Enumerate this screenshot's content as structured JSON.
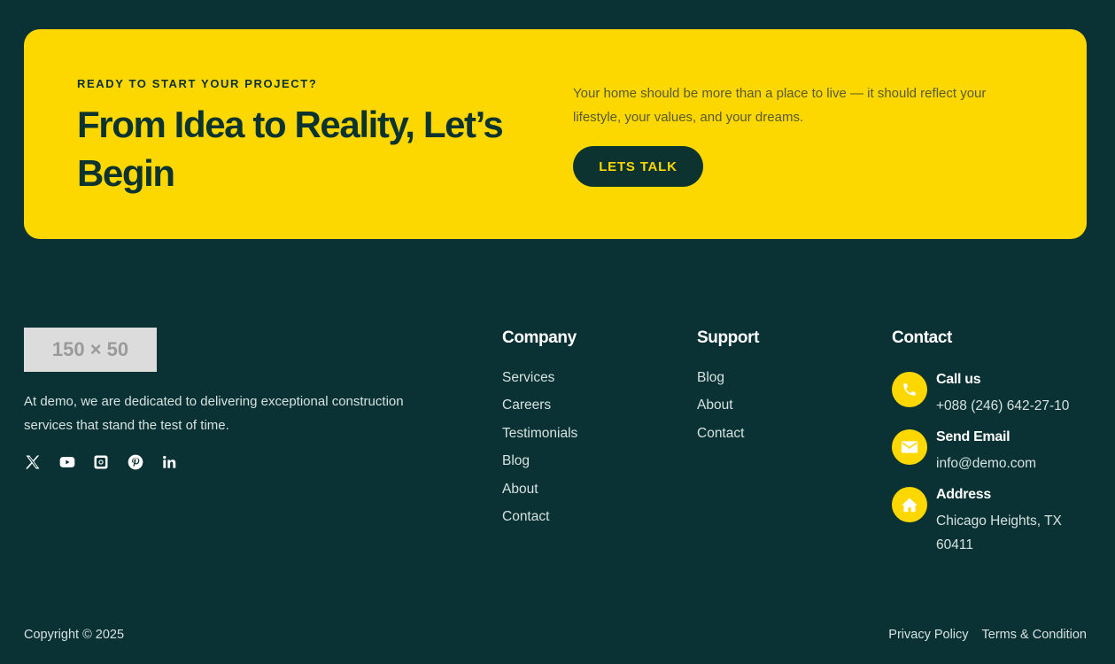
{
  "cta": {
    "eyebrow": "READY TO START YOUR PROJECT?",
    "title": "From Idea to Reality, Let’s Begin",
    "text": "Your home should be more than a place to live — it should reflect your lifestyle, your values, and your dreams.",
    "button": "LETS TALK"
  },
  "brand": {
    "logo_placeholder": "150 × 50",
    "description": "At demo, we are dedicated to delivering exceptional construction services that stand the test of time.",
    "socials": [
      "x-icon",
      "youtube-icon",
      "instagram-icon",
      "pinterest-icon",
      "linkedin-icon"
    ]
  },
  "company": {
    "title": "Company",
    "links": [
      "Services",
      "Careers",
      "Testimonials",
      "Blog",
      "About",
      "Contact"
    ]
  },
  "support": {
    "title": "Support",
    "links": [
      "Blog",
      "About",
      "Contact"
    ]
  },
  "contact": {
    "title": "Contact",
    "items": [
      {
        "icon": "phone-icon",
        "label": "Call us",
        "value": "+088 (246) 642-27-10"
      },
      {
        "icon": "envelope-icon",
        "label": "Send Email",
        "value": "info@demo.com"
      },
      {
        "icon": "home-icon",
        "label": "Address",
        "value": "Chicago Heights, TX 60411"
      }
    ]
  },
  "footer": {
    "copyright": "Copyright © 2025",
    "privacy": "Privacy Policy",
    "terms": "Terms & Condition"
  },
  "colors": {
    "background": "#0a3133",
    "accent": "#fcd800",
    "dark_text": "#0d3331"
  }
}
